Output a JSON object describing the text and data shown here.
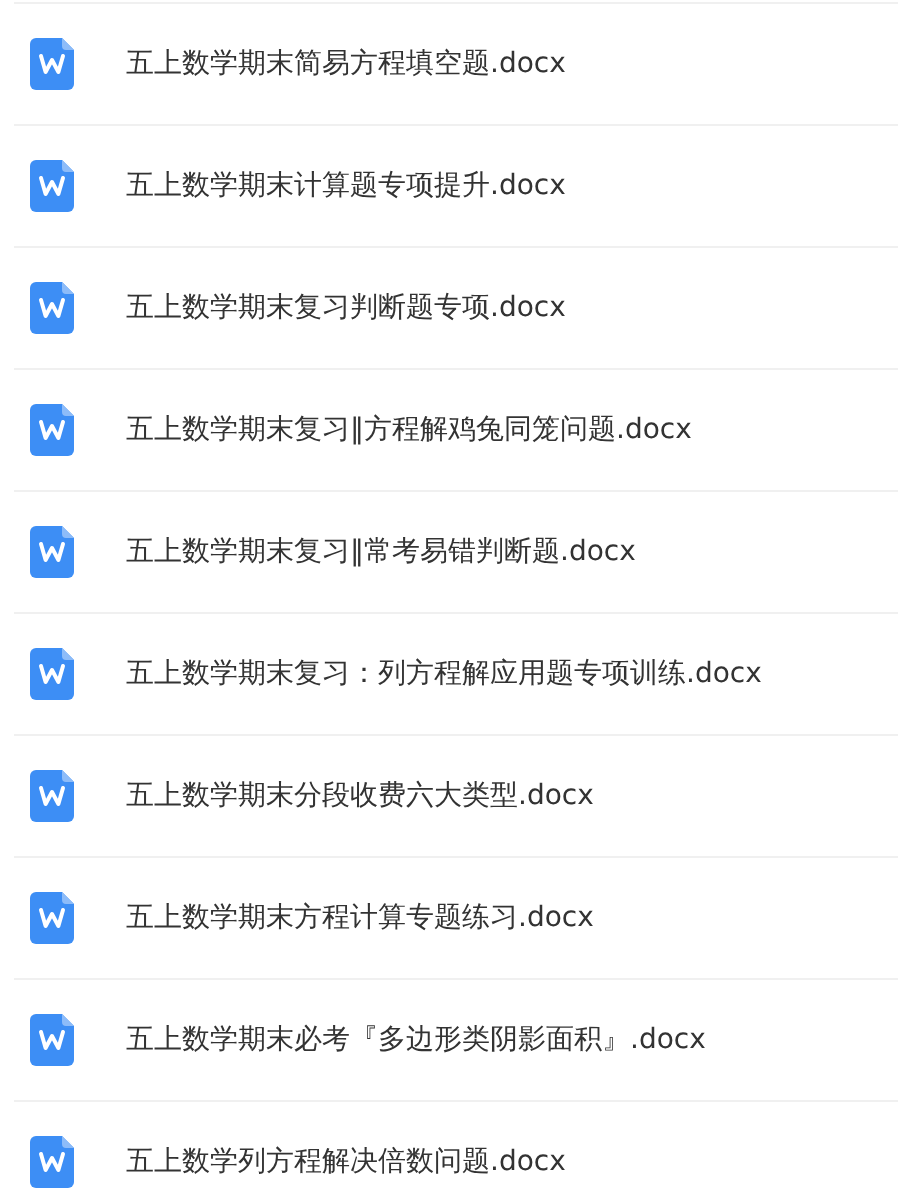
{
  "files": [
    {
      "name": "五上数学期末简易方程填空题.docx"
    },
    {
      "name": "五上数学期末计算题专项提升.docx"
    },
    {
      "name": "五上数学期末复习判断题专项.docx"
    },
    {
      "name": "五上数学期末复习‖方程解鸡兔同笼问题.docx"
    },
    {
      "name": "五上数学期末复习‖常考易错判断题.docx"
    },
    {
      "name": "五上数学期末复习：列方程解应用题专项训练.docx"
    },
    {
      "name": "五上数学期末分段收费六大类型.docx"
    },
    {
      "name": "五上数学期末方程计算专题练习.docx"
    },
    {
      "name": "五上数学期末必考『多边形类阴影面积』.docx"
    },
    {
      "name": "五上数学列方程解决倍数问题.docx"
    }
  ]
}
